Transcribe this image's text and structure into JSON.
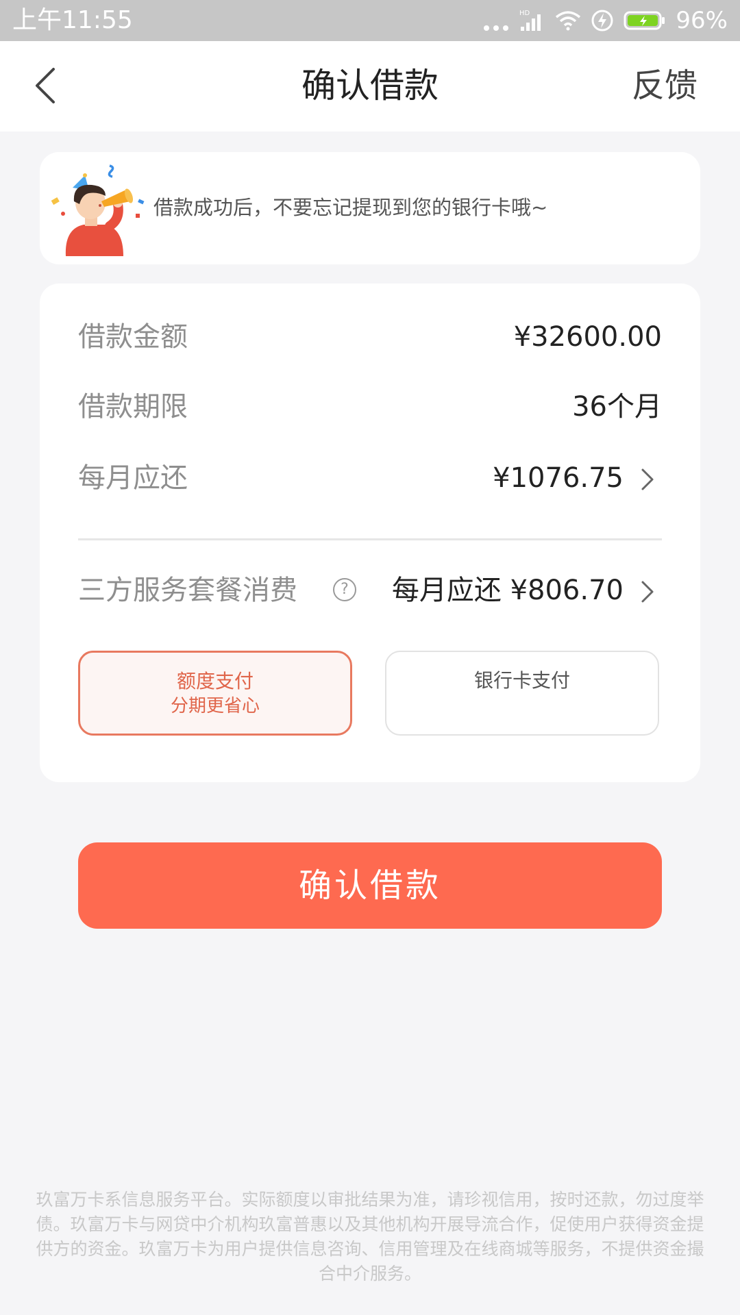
{
  "status_bar": {
    "time": "上午11:55",
    "network_label": "HD",
    "battery_percent": "96%"
  },
  "nav": {
    "title": "确认借款",
    "feedback_label": "反馈"
  },
  "tip": {
    "text": "借款成功后，不要忘记提现到您的银行卡哦~"
  },
  "details": {
    "amount_label": "借款金额",
    "amount_value": "¥32600.00",
    "term_label": "借款期限",
    "term_value": "36个月",
    "monthly_label": "每月应还",
    "monthly_value": "¥1076.75",
    "service_label": "三方服务套餐消费",
    "service_help_glyph": "?",
    "service_value": "每月应还 ¥806.70"
  },
  "payment_options": {
    "quota": {
      "line1": "额度支付",
      "line2": "分期更省心"
    },
    "bank_card": {
      "line1": "银行卡支付"
    },
    "selected": "quota"
  },
  "confirm_label": "确认借款",
  "disclaimer": "玖富万卡系信息服务平台。实际额度以审批结果为准，请珍视信用，按时还款，勿过度举债。玖富万卡与网贷中介机构玖富普惠以及其他机构开展导流合作，促使用户获得资金提供方的资金。玖富万卡为用户提供信息咨询、信用管理及在线商城等服务，不提供资金撮合中介服务。",
  "colors": {
    "accent": "#fe6a50",
    "selected_border": "#e8795f",
    "status_bar_bg": "#c6c6c6",
    "page_bg": "#f5f5f7",
    "battery_green": "#7ed321"
  }
}
